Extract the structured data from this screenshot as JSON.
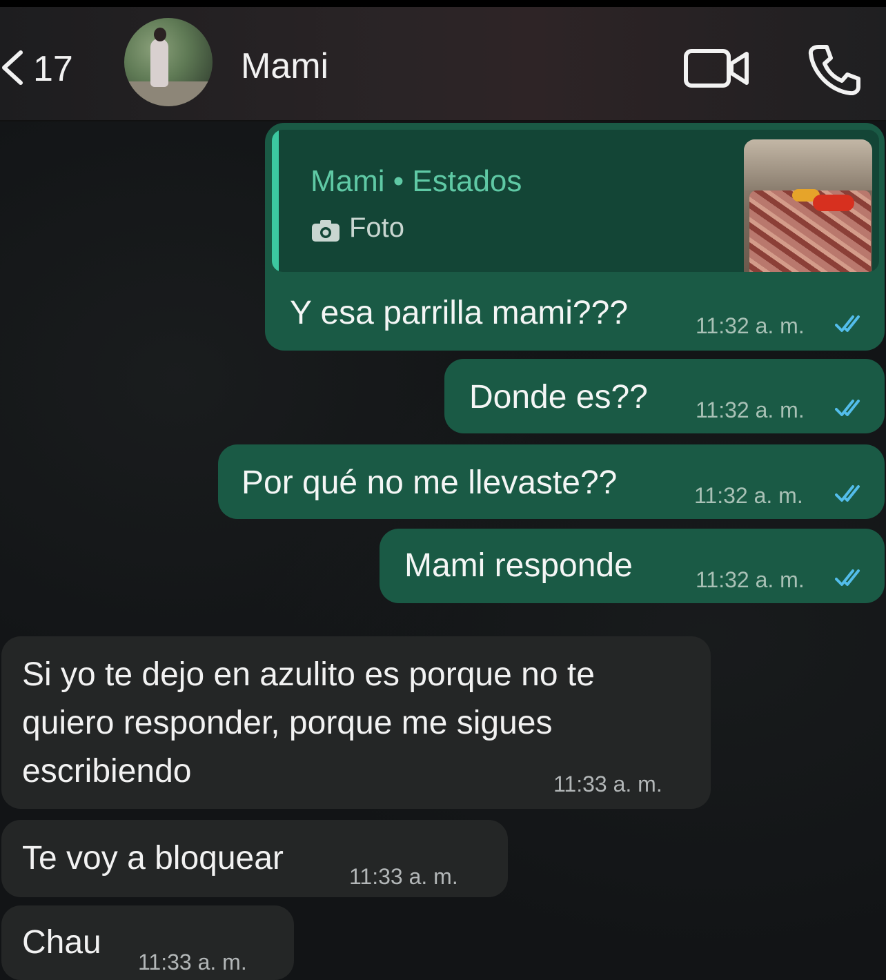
{
  "header": {
    "back_count": "17",
    "contact_name": "Mami",
    "icons": {
      "back": "chevron-left-icon",
      "video": "video-camera-icon",
      "call": "phone-icon"
    }
  },
  "messages": [
    {
      "direction": "outgoing",
      "reply_to": {
        "title": "Mami • Estados",
        "subtitle": "Foto",
        "icon": "camera-icon"
      },
      "text": "Y esa parrilla mami???",
      "time": "11:32 a. m.",
      "status": "read"
    },
    {
      "direction": "outgoing",
      "text": "Donde es??",
      "time": "11:32 a. m.",
      "status": "read"
    },
    {
      "direction": "outgoing",
      "text": "Por qué no me llevaste??",
      "time": "11:32 a. m.",
      "status": "read"
    },
    {
      "direction": "outgoing",
      "text": "Mami responde",
      "time": "11:32 a. m.",
      "status": "read"
    },
    {
      "direction": "incoming",
      "lines": [
        "Si yo te dejo en azulito es porque no te",
        "quiero responder, porque me sigues",
        "escribiendo"
      ],
      "time": "11:33 a. m."
    },
    {
      "direction": "incoming",
      "text": "Te voy a bloquear",
      "time": "11:33 a. m."
    },
    {
      "direction": "incoming",
      "text": "Chau",
      "time": "11:33 a. m."
    }
  ],
  "colors": {
    "outgoing_bubble": "#1a5a45",
    "incoming_bubble": "#242626",
    "read_ticks": "#53bdeb",
    "quote_accent": "#3cc8a0"
  }
}
